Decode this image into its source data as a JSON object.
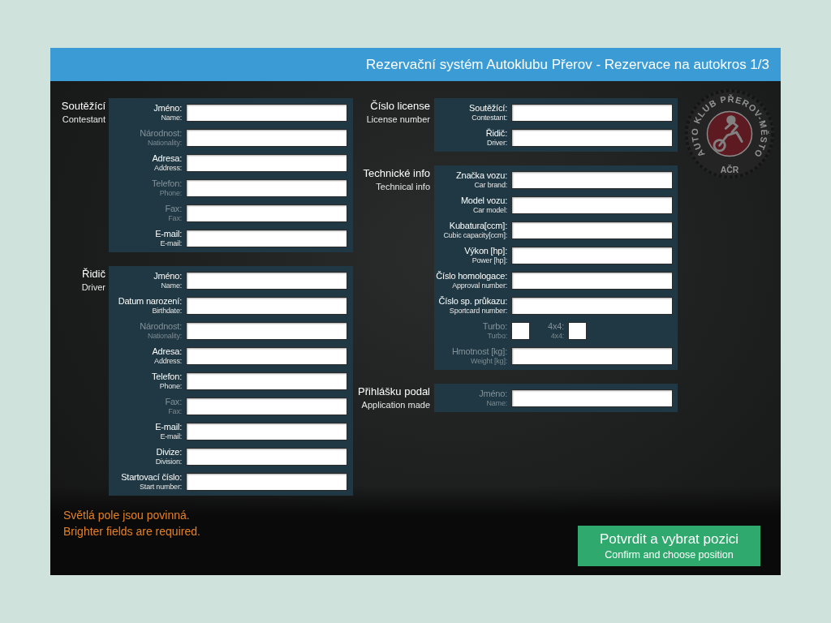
{
  "header": {
    "title": "Rezervační systém Autoklubu Přerov - Rezervace na autokros 1/3"
  },
  "logo": {
    "arc_text": "AUTO KLUB PŘEROV-MĚSTO",
    "bottom_text": "AČR"
  },
  "left_sections": [
    {
      "title": "Soutěžící",
      "subtitle": "Contestant",
      "fields": [
        {
          "kind": "text",
          "label": "Jméno:",
          "sublabel": "Name:",
          "required": true
        },
        {
          "kind": "text",
          "label": "Národnost:",
          "sublabel": "Nationality:",
          "required": false
        },
        {
          "kind": "text",
          "label": "Adresa:",
          "sublabel": "Address:",
          "required": true
        },
        {
          "kind": "text",
          "label": "Telefon:",
          "sublabel": "Phone:",
          "required": false
        },
        {
          "kind": "text",
          "label": "Fax:",
          "sublabel": "Fax:",
          "required": false
        },
        {
          "kind": "text",
          "label": "E-mail:",
          "sublabel": "E-mail:",
          "required": true
        }
      ]
    },
    {
      "title": "Řidič",
      "subtitle": "Driver",
      "fields": [
        {
          "kind": "text",
          "label": "Jméno:",
          "sublabel": "Name:",
          "required": true
        },
        {
          "kind": "text",
          "label": "Datum narození:",
          "sublabel": "Birthdate:",
          "required": true
        },
        {
          "kind": "text",
          "label": "Národnost:",
          "sublabel": "Nationality:",
          "required": false
        },
        {
          "kind": "text",
          "label": "Adresa:",
          "sublabel": "Address:",
          "required": true
        },
        {
          "kind": "text",
          "label": "Telefon:",
          "sublabel": "Phone:",
          "required": true
        },
        {
          "kind": "text",
          "label": "Fax:",
          "sublabel": "Fax:",
          "required": false
        },
        {
          "kind": "text",
          "label": "E-mail:",
          "sublabel": "E-mail:",
          "required": true
        },
        {
          "kind": "text",
          "label": "Divize:",
          "sublabel": "Division:",
          "required": true
        },
        {
          "kind": "text",
          "label": "Startovací číslo:",
          "sublabel": "Start number:",
          "required": true
        }
      ]
    }
  ],
  "right_sections": [
    {
      "title": "Číslo license",
      "subtitle": "License number",
      "fields": [
        {
          "kind": "text",
          "label": "Soutěžící:",
          "sublabel": "Contestant:",
          "required": true
        },
        {
          "kind": "text",
          "label": "Řidič:",
          "sublabel": "Driver:",
          "required": true
        }
      ]
    },
    {
      "title": "Technické info",
      "subtitle": "Technical info",
      "fields": [
        {
          "kind": "text",
          "label": "Značka vozu:",
          "sublabel": "Car brand:",
          "required": true
        },
        {
          "kind": "text",
          "label": "Model vozu:",
          "sublabel": "Car model:",
          "required": true
        },
        {
          "kind": "text",
          "label": "Kubatura[ccm]:",
          "sublabel": "Cubic capacity[ccm]:",
          "required": true
        },
        {
          "kind": "text",
          "label": "Výkon [hp]:",
          "sublabel": "Power [hp]:",
          "required": true
        },
        {
          "kind": "text",
          "label": "Číslo homologace:",
          "sublabel": "Approval number:",
          "required": true
        },
        {
          "kind": "text",
          "label": "Číslo sp. průkazu:",
          "sublabel": "Sportcard number:",
          "required": true
        },
        {
          "kind": "checkboxes",
          "required": false,
          "items": [
            {
              "label": "Turbo:",
              "sublabel": "Turbo:",
              "checked": false
            },
            {
              "label": "4x4:",
              "sublabel": "4x4:",
              "checked": false
            }
          ]
        },
        {
          "kind": "text",
          "label": "Hmotnost [kg]:",
          "sublabel": "Weight [kg]:",
          "required": false
        }
      ]
    },
    {
      "title": "Přihlášku podal",
      "subtitle": "Application made",
      "fields": [
        {
          "kind": "text",
          "label": "Jméno:",
          "sublabel": "Name:",
          "required": false
        }
      ]
    }
  ],
  "note": {
    "lines": [
      "Světlá pole jsou povinná.",
      "Brighter fields are required."
    ]
  },
  "submit_button": {
    "label": "Potvrdit a vybrat pozici",
    "sublabel": "Confirm and choose position"
  }
}
